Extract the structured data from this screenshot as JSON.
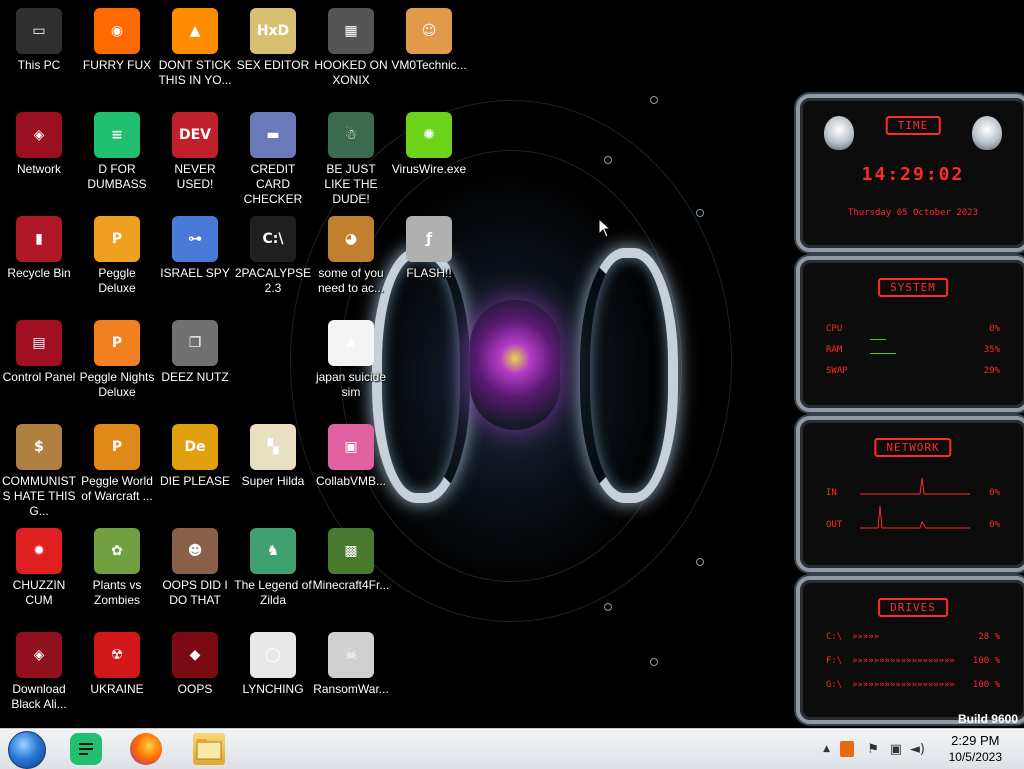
{
  "desktop_icons": [
    {
      "label": "This PC",
      "icon": "computer-icon",
      "color": "#303030",
      "glyph": "▭"
    },
    {
      "label": "FURRY FUX",
      "icon": "firefox-icon",
      "color": "#ff6a00",
      "glyph": "◉"
    },
    {
      "label": "DONT STICK THIS IN YO...",
      "icon": "vlc-icon",
      "color": "#ff8c00",
      "glyph": "▲"
    },
    {
      "label": "SEX EDITOR",
      "icon": "hex-editor-icon",
      "color": "#d8c070",
      "glyph": "HxD"
    },
    {
      "label": "HOOKED ON XONIX",
      "icon": "xonix-icon",
      "color": "#555555",
      "glyph": "▦"
    },
    {
      "label": "VM0Technic...",
      "icon": "technician-icon",
      "color": "#e09a4a",
      "glyph": "☺"
    },
    {
      "label": "Network",
      "icon": "alienware-network-icon",
      "color": "#9a1020",
      "glyph": "◈"
    },
    {
      "label": "D FOR DUMBASS",
      "icon": "dfd-icon",
      "color": "#20c070",
      "glyph": "≡"
    },
    {
      "label": "NEVER USED!",
      "icon": "devcpp-icon",
      "color": "#c0202a",
      "glyph": "DEV"
    },
    {
      "label": "CREDIT CARD CHECKER",
      "icon": "credit-card-icon",
      "color": "#6a7ab8",
      "glyph": "▬"
    },
    {
      "label": "BE JUST LIKE THE DUDE!",
      "icon": "santa-icon",
      "color": "#3a6a50",
      "glyph": "☃"
    },
    {
      "label": "VirusWire.exe",
      "icon": "limewire-icon",
      "color": "#6cd21a",
      "glyph": "✺"
    },
    {
      "label": "Recycle Bin",
      "icon": "recycle-bin-icon",
      "color": "#b01828",
      "glyph": "▮"
    },
    {
      "label": "Peggle Deluxe",
      "icon": "peggle-icon",
      "color": "#f0a020",
      "glyph": "P"
    },
    {
      "label": "ISRAEL SPY",
      "icon": "network-spy-icon",
      "color": "#4a7ad8",
      "glyph": "⊶"
    },
    {
      "label": "2PACALYPSE 2.3",
      "icon": "cmd-icon",
      "color": "#202020",
      "glyph": "C:\\"
    },
    {
      "label": "some of you need to ac...",
      "icon": "dog-icon",
      "color": "#c08030",
      "glyph": "◕"
    },
    {
      "label": "FLASH!!",
      "icon": "flash-icon",
      "color": "#b0b0b0",
      "glyph": "ƒ"
    },
    {
      "label": "Control Panel",
      "icon": "control-panel-icon",
      "color": "#a01020",
      "glyph": "▤"
    },
    {
      "label": "Peggle Nights Deluxe",
      "icon": "peggle-nights-icon",
      "color": "#f08020",
      "glyph": "P"
    },
    {
      "label": "DEEZ NUTZ",
      "icon": "windows-stack-icon",
      "color": "#707070",
      "glyph": "❐"
    },
    {
      "label": "japan suicide sim",
      "icon": "document-icon",
      "color": "#f4f4f4",
      "glyph": "♟"
    },
    {
      "label": "COMMUNISTS HATE THIS G...",
      "icon": "money-bag-icon",
      "color": "#b08040",
      "glyph": "$"
    },
    {
      "label": "Peggle World of Warcraft ...",
      "icon": "peggle-wow-icon",
      "color": "#e08818",
      "glyph": "P"
    },
    {
      "label": "DIE PLEASE",
      "icon": "de-icon",
      "color": "#e0a010",
      "glyph": "De"
    },
    {
      "label": "Super Hilda",
      "icon": "pixel-dog-icon",
      "color": "#e8e0c0",
      "glyph": "▚"
    },
    {
      "label": "CollabVMB...",
      "icon": "monitor-icon",
      "color": "#e060a0",
      "glyph": "▣"
    },
    {
      "label": "CHUZZIN CUM",
      "icon": "chuzzle-icon",
      "color": "#e02020",
      "glyph": "✹"
    },
    {
      "label": "Plants vs Zombies",
      "icon": "pvz-icon",
      "color": "#70a040",
      "glyph": "✿"
    },
    {
      "label": "OOPS DID I DO THAT",
      "icon": "portrait-icon",
      "color": "#8a6048",
      "glyph": "☻"
    },
    {
      "label": "The Legend of Zilda",
      "icon": "zelda-icon",
      "color": "#40a070",
      "glyph": "♞"
    },
    {
      "label": "Minecraft4Fr...",
      "icon": "minecraft-icon",
      "color": "#4a7a30",
      "glyph": "▩"
    },
    {
      "label": "Download Black Ali...",
      "icon": "alienware-download-icon",
      "color": "#901020",
      "glyph": "◈"
    },
    {
      "label": "UKRAINE",
      "icon": "radiation-icon",
      "color": "#d01818",
      "glyph": "☢"
    },
    {
      "label": "OOPS",
      "icon": "alienware-oops-icon",
      "color": "#7a0a14",
      "glyph": "◆"
    },
    {
      "label": "LYNCHING",
      "icon": "rope-icon",
      "color": "#e8e8e8",
      "glyph": "◯"
    },
    {
      "label": "RansomWar...",
      "icon": "skull-icon",
      "color": "#d0d0d0",
      "glyph": "☠"
    }
  ],
  "widget": {
    "time": {
      "title": "TIME",
      "clock": "14:29:02",
      "date": "Thursday 05 October 2023"
    },
    "system": {
      "title": "SYSTEM",
      "rows": [
        {
          "k": "CPU",
          "v": "0%"
        },
        {
          "k": "RAM",
          "v": "35%"
        },
        {
          "k": "SWAP",
          "v": "29%"
        }
      ]
    },
    "network": {
      "title": "NETWORK",
      "rows": [
        {
          "k": "IN",
          "v": "0%"
        },
        {
          "k": "OUT",
          "v": "0%"
        }
      ]
    },
    "drives": {
      "title": "DRIVES",
      "rows": [
        {
          "k": "C:\\",
          "bar": "»»»»»",
          "v": "28 %"
        },
        {
          "k": "F:\\",
          "bar": "»»»»»»»»»»»»»»»»»»»",
          "v": "100 %"
        },
        {
          "k": "G:\\",
          "bar": "»»»»»»»»»»»»»»»»»»»",
          "v": "100 %"
        }
      ]
    }
  },
  "build_text": "Build 9600",
  "taskbar": {
    "clock_time": "2:29 PM",
    "clock_date": "10/5/2023"
  },
  "colors": {
    "accent_red": "#ff2a2a",
    "taskbar": "#e8eaee"
  }
}
